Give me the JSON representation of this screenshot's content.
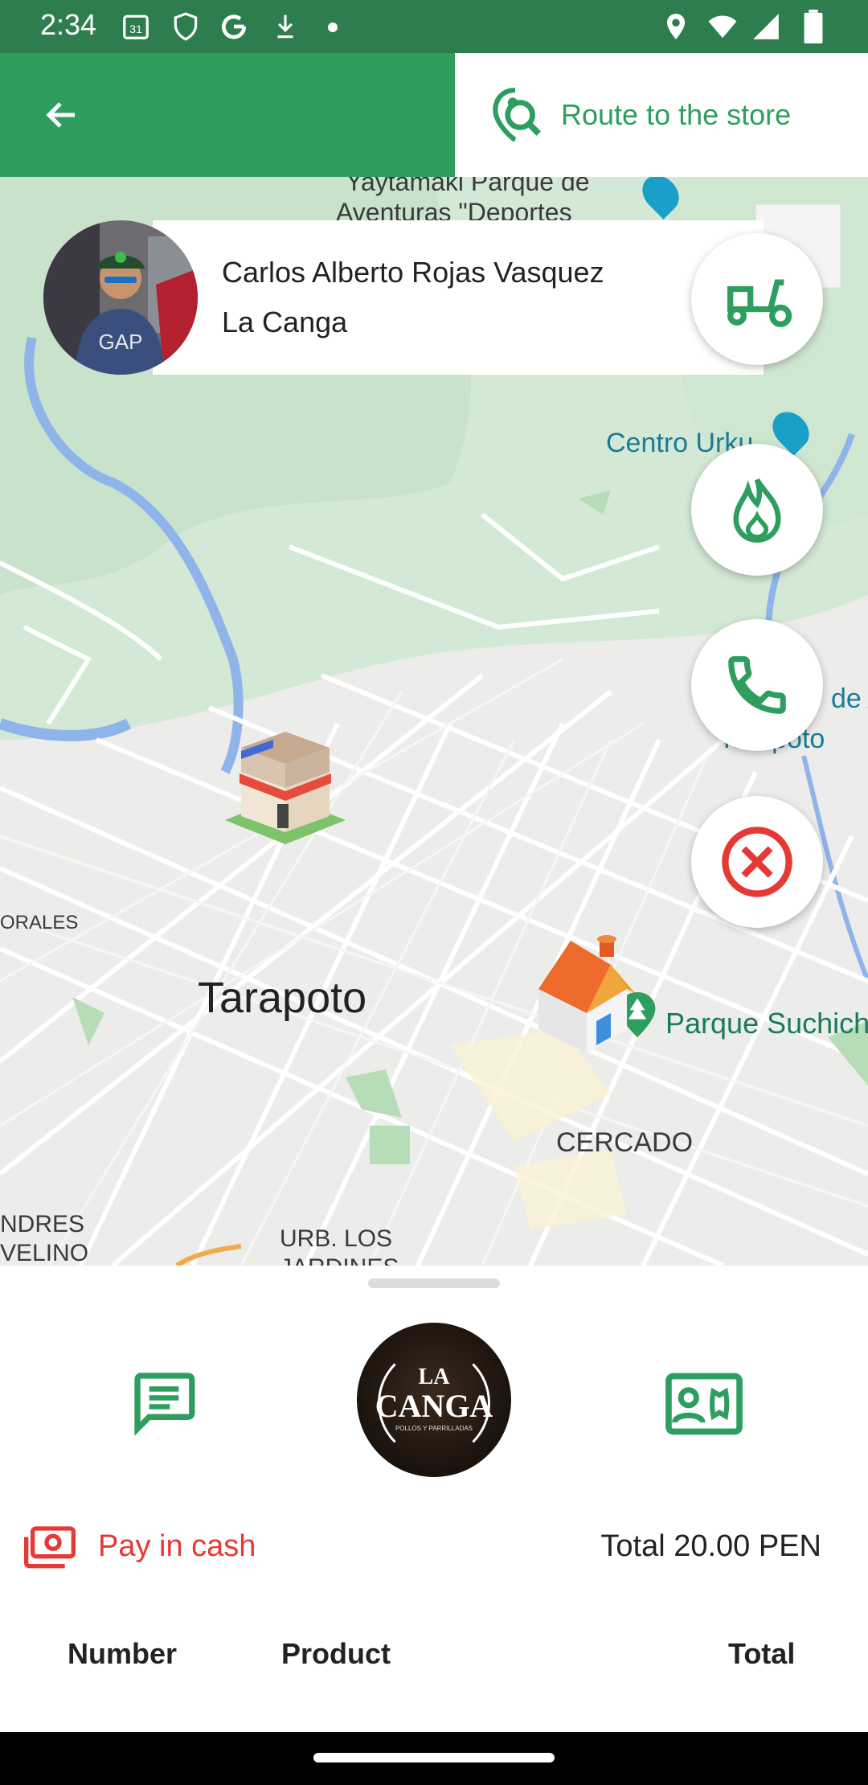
{
  "status_bar": {
    "time": "2:34",
    "calendar_day": "31",
    "icons_left": [
      "calendar-icon",
      "shield-icon",
      "google-icon",
      "download-icon",
      "dot-icon"
    ],
    "icons_right": [
      "location-icon",
      "wifi-icon",
      "signal-icon",
      "battery-icon"
    ]
  },
  "app_bar": {
    "back_icon": "arrow-back-icon",
    "route_button_label": "Route to the store",
    "route_icon": "map-search-icon",
    "accent": "#2e9e5f"
  },
  "driver": {
    "name": "Carlos Alberto Rojas Vasquez",
    "store": "La Canga"
  },
  "actions": {
    "delivery_icon": "scooter-icon",
    "fire_icon": "flame-icon",
    "call_icon": "phone-icon",
    "cancel_icon": "cancel-circle-icon",
    "cancel_color": "#e53935"
  },
  "map": {
    "labels": {
      "park": "Yaytamaki Parque de",
      "park2": "Aventuras \"Deportes",
      "centro": "Centro Urku",
      "city": "Tarapoto",
      "suchiche": "Parque Suchich",
      "cercado": "CERCADO",
      "morales": "ORALES",
      "andres": "NDRES",
      "avelino": "VELINO",
      "urb": "URB. LOS",
      "jardines": "JARDINES",
      "dea": "de A",
      "tarapoto_right": "Tarapoto"
    },
    "markers": [
      "store-marker-icon",
      "home-marker-icon"
    ]
  },
  "sheet": {
    "chat_icon": "chat-icon",
    "contact_icon": "contact-phone-icon",
    "logo_title": "LA",
    "logo_name": "CANGA",
    "logo_sub": "POLLOS Y PARRILLADAS",
    "payment_icon": "cash-icon",
    "payment_label": "Pay in cash",
    "total_label": "Total 20.00 PEN",
    "columns": [
      "Number",
      "Product",
      "Total"
    ]
  }
}
